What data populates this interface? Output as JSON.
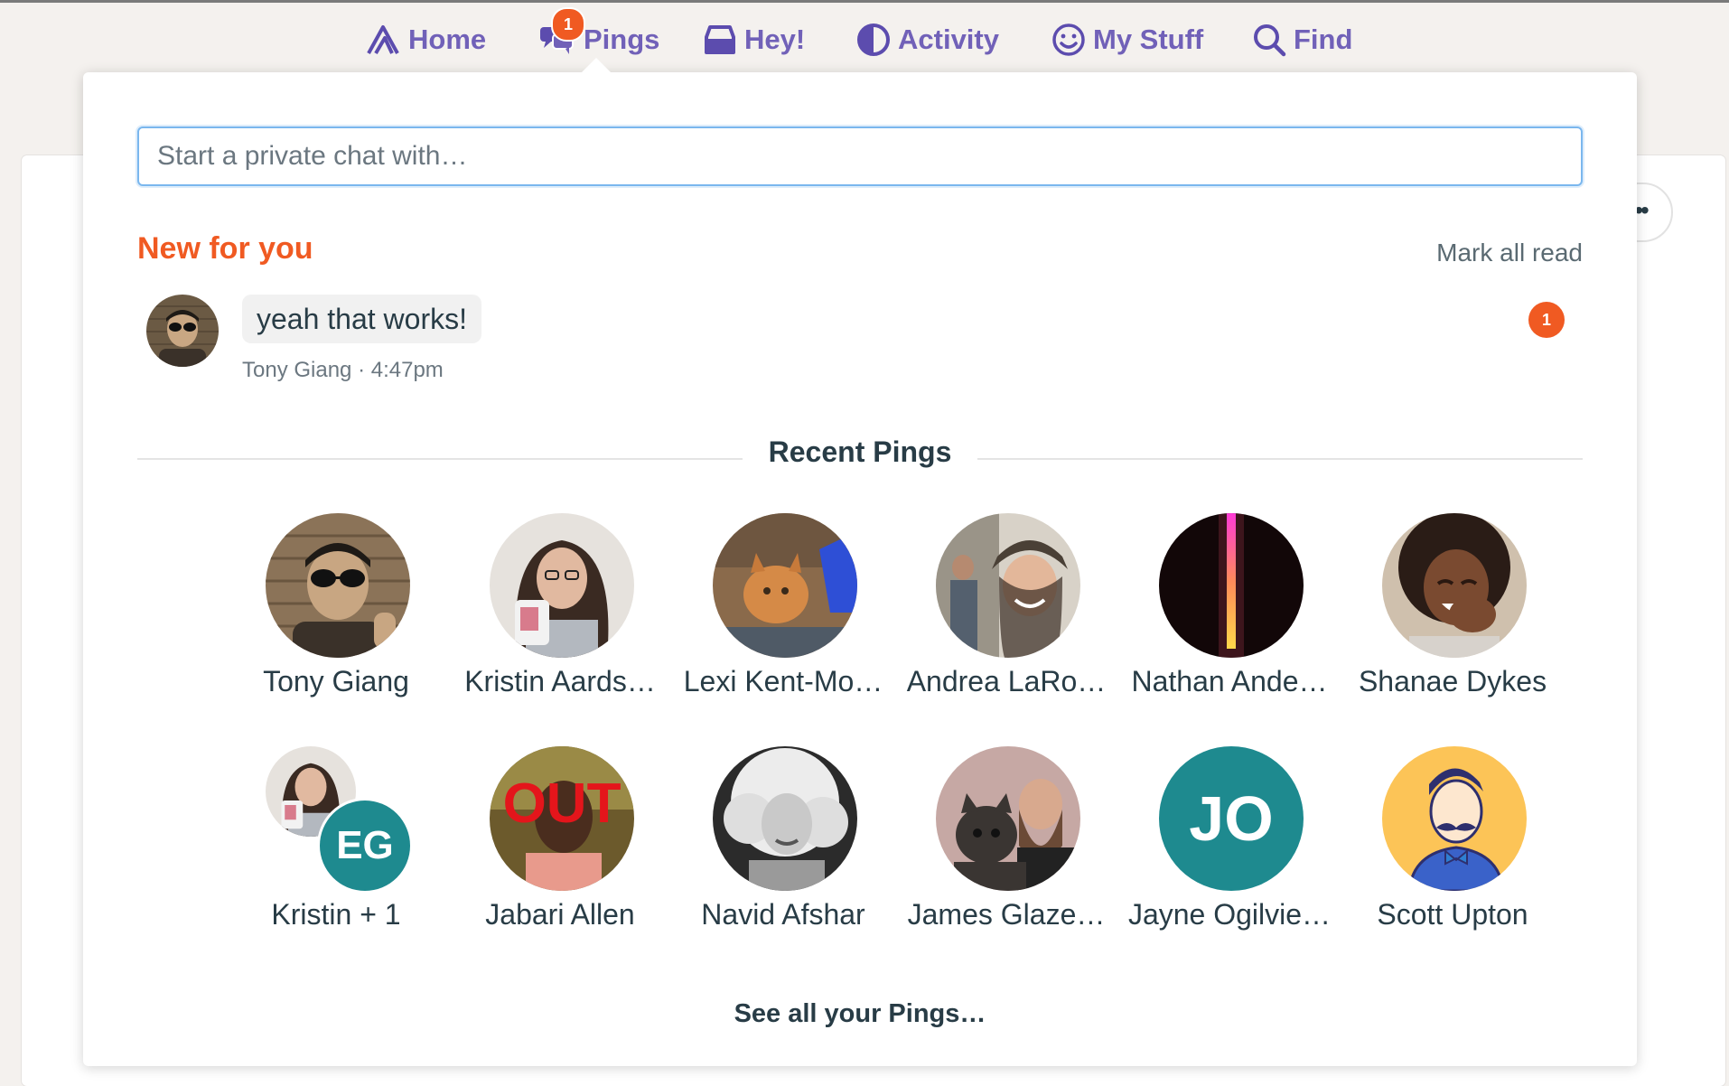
{
  "nav": {
    "items": [
      {
        "label": "Home",
        "icon": "home-icon"
      },
      {
        "label": "Pings",
        "icon": "pings-icon",
        "badge": "1"
      },
      {
        "label": "Hey!",
        "icon": "inbox-tray-icon"
      },
      {
        "label": "Activity",
        "icon": "activity-pie-icon"
      },
      {
        "label": "My Stuff",
        "icon": "smiley-icon"
      },
      {
        "label": "Find",
        "icon": "magnifier-icon"
      }
    ],
    "accent_color": "#5c4cae",
    "badge_color": "#f05a22"
  },
  "search": {
    "placeholder": "Start a private chat with…"
  },
  "new_section": {
    "heading": "New for you",
    "mark_all_read": "Mark all read",
    "items": [
      {
        "message": "yeah that works!",
        "author": "Tony Giang",
        "separator": "·",
        "time": "4:47pm",
        "unread_count": "1"
      }
    ]
  },
  "recent": {
    "heading": "Recent Pings",
    "people": [
      {
        "name": "Tony Giang"
      },
      {
        "name": "Kristin Aards…"
      },
      {
        "name": "Lexi Kent-Mo…"
      },
      {
        "name": "Andrea LaRo…"
      },
      {
        "name": "Nathan Ande…"
      },
      {
        "name": "Shanae Dykes"
      },
      {
        "name": "Kristin + 1",
        "initials": "EG"
      },
      {
        "name": "Jabari Allen",
        "avatar_text": "OUT"
      },
      {
        "name": "Navid Afshar"
      },
      {
        "name": "James Glaze…"
      },
      {
        "name": "Jayne Ogilvie…",
        "initials": "JO"
      },
      {
        "name": "Scott Upton"
      }
    ],
    "see_all": "See all your Pings…"
  },
  "colors": {
    "orange": "#f05a22",
    "initials_teal": "#1e8a8f",
    "text_dark": "#283c46"
  }
}
